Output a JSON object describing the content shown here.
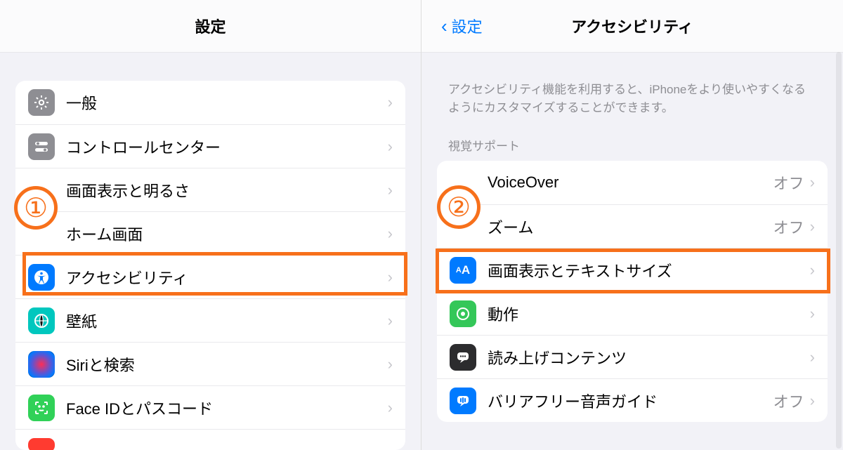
{
  "left": {
    "title": "設定",
    "badge": "①",
    "items": [
      {
        "label": "一般",
        "icon": "gear-icon",
        "icClass": "ic-grey"
      },
      {
        "label": "コントロールセンター",
        "icon": "switches-icon",
        "icClass": "ic-grey2"
      },
      {
        "label": "画面表示と明るさ",
        "icon": "display-icon",
        "icClass": "ic-blue"
      },
      {
        "label": "ホーム画面",
        "icon": "home-icon",
        "icClass": "ic-blue"
      },
      {
        "label": "アクセシビリティ",
        "icon": "accessibility-icon",
        "icClass": "ic-blue",
        "highlighted": true
      },
      {
        "label": "壁紙",
        "icon": "wallpaper-icon",
        "icClass": "ic-teal"
      },
      {
        "label": "Siriと検索",
        "icon": "siri-icon",
        "icClass": "ic-black"
      },
      {
        "label": "Face IDとパスコード",
        "icon": "faceid-icon",
        "icClass": "ic-green2"
      }
    ]
  },
  "right": {
    "back": "設定",
    "title": "アクセシビリティ",
    "badge": "②",
    "note": "アクセシビリティ機能を利用すると、iPhoneをより使いやすくなるようにカスタマイズすることができます。",
    "section": "視覚サポート",
    "items": [
      {
        "label": "VoiceOver",
        "value": "オフ",
        "icon": "voiceover-icon",
        "icClass": "ic-black"
      },
      {
        "label": "ズーム",
        "value": "オフ",
        "icon": "zoom-icon",
        "icClass": "ic-black"
      },
      {
        "label": "画面表示とテキストサイズ",
        "icon": "textsize-icon",
        "icClass": "ic-blue",
        "highlighted": true
      },
      {
        "label": "動作",
        "icon": "motion-icon",
        "icClass": "ic-green"
      },
      {
        "label": "読み上げコンテンツ",
        "icon": "speech-icon",
        "icClass": "ic-dark"
      },
      {
        "label": "バリアフリー音声ガイド",
        "value": "オフ",
        "icon": "audio-icon",
        "icClass": "ic-blue"
      }
    ]
  }
}
